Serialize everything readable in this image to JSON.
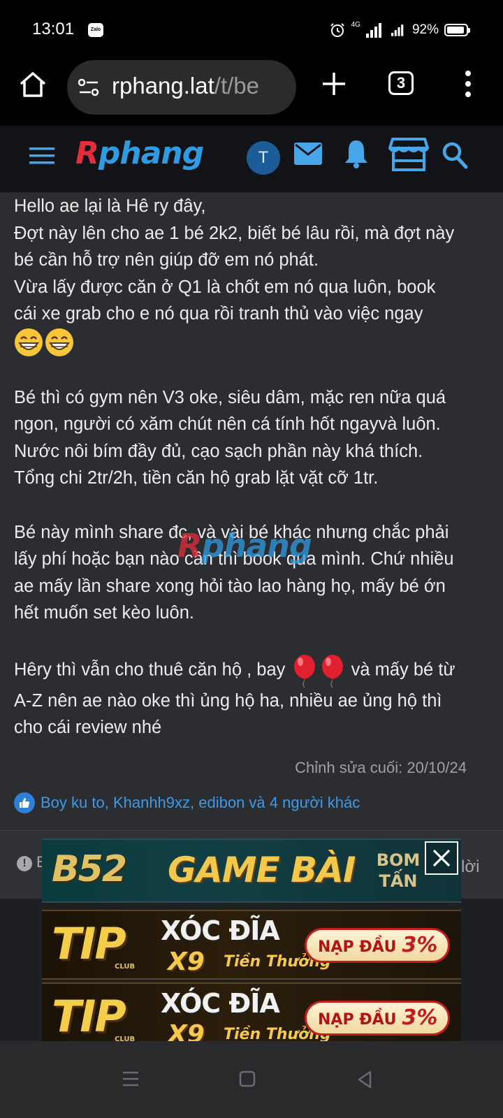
{
  "status_bar": {
    "time": "13:01",
    "notification_app": "Zalo",
    "network": "4G",
    "battery_percent": "92%",
    "battery_level": 0.92,
    "icons": [
      "alarm-icon",
      "signal-icon",
      "battery-icon"
    ]
  },
  "browser": {
    "url_host": "rphang.lat",
    "url_path": "/t/be",
    "tab_count": "3",
    "icons": [
      "home-icon",
      "site-settings-icon",
      "plus-icon",
      "more-vert-icon"
    ]
  },
  "site_header": {
    "logo_r": "R",
    "logo_rest": "phang",
    "avatar_initial": "T",
    "icons": [
      "menu-icon",
      "mail-icon",
      "bell-icon",
      "store-icon",
      "search-icon"
    ],
    "colors": {
      "logo_red": "#e32d3c",
      "logo_blue": "#2f9be3",
      "icon_blue": "#47a6e8",
      "avatar_bg": "#1c5d99"
    }
  },
  "post": {
    "p1": [
      "Hello ae lại là Hê ry đây,",
      "Đợt này lên cho ae 1 bé 2k2, biết bé lâu rồi, mà đợt này",
      "bé cần hỗ trợ nên giúp đỡ em nó phát.",
      "Vừa lấy được căn ở Q1 là chốt em nó qua luôn, book",
      "cái xe grab cho e nó qua rồi tranh thủ vào việc ngay"
    ],
    "p2": [
      "Bé thì có gym nên V3 oke, siêu dâm, mặc ren nữa quá",
      "ngon, người có xăm chút nên cá tính hốt ngayvà luôn.",
      "Nước nôi bím đầy đủ, cạo sạch phần này khá thích.",
      "Tổng chi 2tr/2h, tiền căn hộ grab lặt vặt cỡ 1tr."
    ],
    "p3": [
      "Bé này mình share đc, và vài bé khác nhưng chắc phải",
      "lấy phí hoặc bạn nào cần thì book qua mình. Chứ nhiều",
      "ae mấy lần share xong hỏi tào lao hàng họ, mấy bé ớn",
      "hết muốn set kèo luôn."
    ],
    "p4_before": "Hêry thì vẫn cho thuê căn hộ , bay",
    "p4_after": "và mấy bé từ",
    "p4_rest": [
      "A-Z nên ae nào oke thì ủng hộ ha, nhiều ae ủng hộ thì",
      "cho cái review nhé"
    ],
    "emojis": [
      "grinning-face-icon",
      "grinning-face-icon",
      "balloon-icon",
      "balloon-icon"
    ],
    "watermark_r": "R",
    "watermark_rest": "phang",
    "edited": "Chỉnh sửa cuối: 20/10/24",
    "reactions": "Boy ku to, Khanhh9xz, edibon và 4 người khác",
    "report_partial": "B",
    "reply_partial": "lời"
  },
  "ads": {
    "b52": {
      "logo": "B52",
      "title": "GAME BÀI",
      "tag_line1": "BOM",
      "tag_line2": "TẤN"
    },
    "tip": {
      "logo": "TIP",
      "club": "CLUB",
      "title": "XÓC ĐĨA",
      "x9": "X9",
      "bonus": "Tiền Thưởng",
      "badge": "NẠP ĐẦU",
      "pct": "3%"
    }
  },
  "nav_bar": {
    "icons": [
      "recents-icon",
      "home-icon",
      "back-icon"
    ]
  }
}
